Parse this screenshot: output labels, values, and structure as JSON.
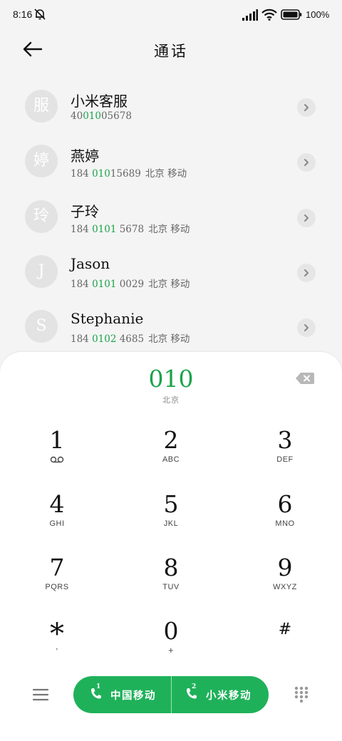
{
  "status_bar": {
    "time": "8:16",
    "battery": "100%"
  },
  "header": {
    "title": "通话"
  },
  "contacts": [
    {
      "avatar": "服",
      "name": "小米客服",
      "num_pre": "40",
      "num_hl": "010",
      "num_post": "05678",
      "location": ""
    },
    {
      "avatar": "婷",
      "name": "燕婷",
      "num_pre": "184 ",
      "num_hl": "010",
      "num_post": "15689",
      "location": "北京 移动"
    },
    {
      "avatar": "玲",
      "name": "子玲",
      "num_pre": "184 ",
      "num_hl": "0101",
      "num_post": " 5678",
      "location": "北京 移动"
    },
    {
      "avatar": "J",
      "name": "Jason",
      "num_pre": "184 ",
      "num_hl": "0101",
      "num_post": " 0029",
      "location": "北京 移动"
    },
    {
      "avatar": "S",
      "name": "Stephanie",
      "num_pre": "184 ",
      "num_hl": "0102",
      "num_post": " 4685",
      "location": "北京 移动"
    }
  ],
  "dialer": {
    "number": "010",
    "location": "北京"
  },
  "keys": [
    {
      "num": "1",
      "sub": ""
    },
    {
      "num": "2",
      "sub": "ABC"
    },
    {
      "num": "3",
      "sub": "DEF"
    },
    {
      "num": "4",
      "sub": "GHI"
    },
    {
      "num": "5",
      "sub": "JKL"
    },
    {
      "num": "6",
      "sub": "MNO"
    },
    {
      "num": "7",
      "sub": "PQRS"
    },
    {
      "num": "8",
      "sub": "TUV"
    },
    {
      "num": "9",
      "sub": "WXYZ"
    },
    {
      "num": "*",
      "sub": ","
    },
    {
      "num": "0",
      "sub": "+"
    },
    {
      "num": "#",
      "sub": ""
    }
  ],
  "call_buttons": [
    {
      "sim": "1",
      "label": "中国移动"
    },
    {
      "sim": "2",
      "label": "小米移动"
    }
  ],
  "icons": {
    "back": "arrow-left-icon",
    "mute": "bell-off-icon",
    "signal": "signal-icon",
    "wifi": "wifi-icon",
    "battery": "battery-icon",
    "chevron": "chevron-right-icon",
    "backspace": "backspace-icon",
    "voicemail": "voicemail-icon",
    "menu": "menu-icon",
    "phone": "phone-icon",
    "keypad": "keypad-icon"
  },
  "colors": {
    "accent": "#1aa34a",
    "call_button": "#1fb15a",
    "background": "#f4f4f4"
  }
}
